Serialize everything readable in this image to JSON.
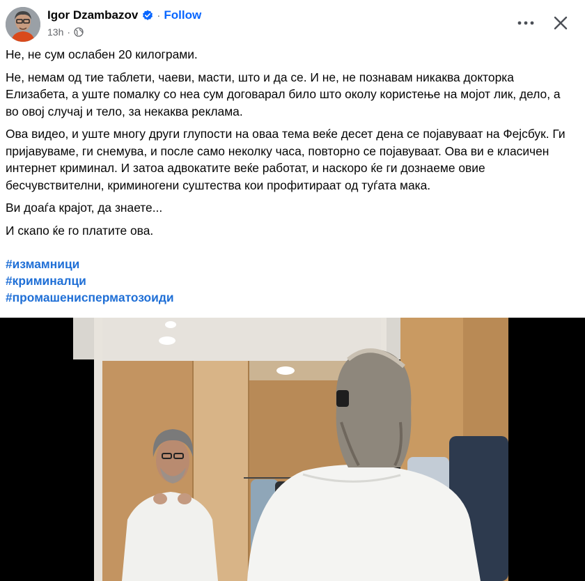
{
  "post": {
    "author": "Igor Dzambazov",
    "follow_label": "Follow",
    "time": "13h",
    "audience_icon": "globe-icon",
    "paragraphs": [
      "Не, не сум ослабен 20 килограми.",
      "Не, немам од тие таблети, чаеви, масти, што и да се. И не, не познавам никаква докторка Елизабета, а уште помалку со неа сум договарал било што околу користење на мојот лик, дело, а во овој случај и тело, за некаква реклама.",
      "Ова видео, и уште многу други глупости на оваа тема веќе десет дена се појавуваат на Фејсбук. Ги пријавуваме, ги снемува, и после само неколку часа, повторно се појавуваат. Ова ви е класичен интернет криминал. И затоа адвокатите веќе работат, и наскоро ќе ги дознаеме овие бесчувствителни, криминогени суштества кои профитираат од туѓата мака.",
      "Ви доаѓа крајот, да знаете...",
      "И скапо ќе го платите ова."
    ],
    "hashtags": [
      "#измамници",
      "#криминалци",
      "#промашениспермaтозоиди"
    ]
  },
  "colors": {
    "link_blue": "#0866ff",
    "hashtag_blue": "#1f6fd6",
    "verified_blue": "#0866ff",
    "muted_gray": "#65676b"
  }
}
